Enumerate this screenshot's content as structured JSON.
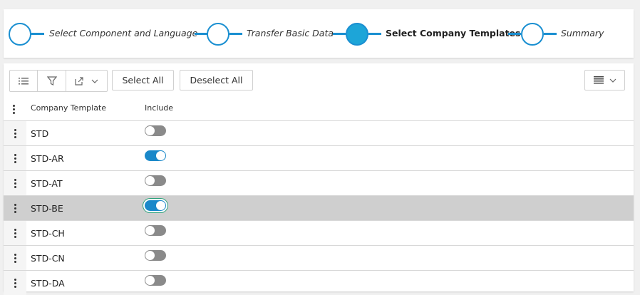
{
  "wizard": {
    "steps": [
      {
        "label": "Select Component and Language",
        "active": false
      },
      {
        "label": "Transfer Basic Data",
        "active": false
      },
      {
        "label": "Select Company Templates",
        "active": true
      },
      {
        "label": "Summary",
        "active": false
      }
    ]
  },
  "toolbar": {
    "select_all_label": "Select All",
    "deselect_all_label": "Deselect All",
    "icons": [
      "list-icon",
      "filter-icon",
      "export-icon",
      "chevron-down-icon",
      "view-density-icon"
    ]
  },
  "table": {
    "columns": [
      "Company Template",
      "Include"
    ],
    "rows": [
      {
        "name": "STD",
        "include": false
      },
      {
        "name": "STD-AR",
        "include": true
      },
      {
        "name": "STD-AT",
        "include": false
      },
      {
        "name": "STD-BE",
        "include": true,
        "selected": true
      },
      {
        "name": "STD-CH",
        "include": false
      },
      {
        "name": "STD-CN",
        "include": false
      },
      {
        "name": "STD-DA",
        "include": false
      }
    ]
  },
  "colors": {
    "accent": "#1a8fd1",
    "active_step_fill": "#1da5d8",
    "toggle_on": "#1a88c9",
    "toggle_off": "#8a8a8a",
    "selected_row": "#cfcfcf"
  }
}
